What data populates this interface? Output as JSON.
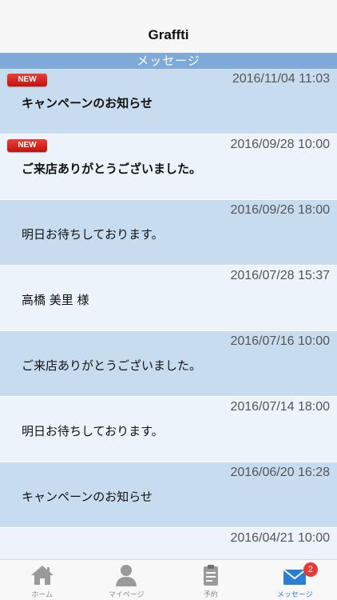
{
  "navbar": {
    "title": "Graffti"
  },
  "section": {
    "title": "メッセージ"
  },
  "messages": [
    {
      "date": "2016/11/04 11:03",
      "title": "キャンペーンのお知らせ",
      "badge": "NEW"
    },
    {
      "date": "2016/09/28 10:00",
      "title": "ご来店ありがとうございました。",
      "badge": "NEW"
    },
    {
      "date": "2016/09/26 18:00",
      "title": "明日お待ちしております。"
    },
    {
      "date": "2016/07/28 15:37",
      "title": "高橋 美里 様"
    },
    {
      "date": "2016/07/16 10:00",
      "title": "ご来店ありがとうございました。"
    },
    {
      "date": "2016/07/14 18:00",
      "title": "明日お待ちしております。"
    },
    {
      "date": "2016/06/20 16:28",
      "title": "キャンペーンのお知らせ"
    },
    {
      "date": "2016/04/21 10:00",
      "title": ""
    }
  ],
  "tabbar": {
    "tabs": [
      {
        "label": "ホーム",
        "icon": "home-icon"
      },
      {
        "label": "マイページ",
        "icon": "person-icon"
      },
      {
        "label": "予約",
        "icon": "clipboard-icon"
      },
      {
        "label": "メッセージ",
        "icon": "envelope-icon",
        "badge": "2"
      }
    ]
  },
  "colors": {
    "accent": "#2a7fd4",
    "header": "#7fa9d6",
    "row_blue": "#c8dcf0",
    "row_light": "#ecf3fb",
    "badge_red": "#d9231d"
  }
}
